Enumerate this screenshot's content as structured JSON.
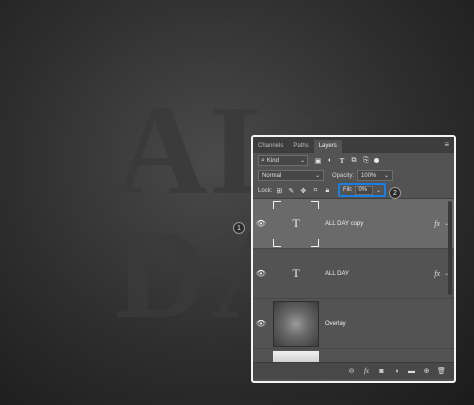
{
  "canvas": {
    "ghost_line_1": "ALL",
    "ghost_line_2": "DAY"
  },
  "panel": {
    "tabs": [
      {
        "label": "Channels",
        "active": false
      },
      {
        "label": "Paths",
        "active": false
      },
      {
        "label": "Layers",
        "active": true
      }
    ],
    "menu_icon": "panel-menu-icon",
    "filter": {
      "kind_label": "Kind",
      "icons": [
        "image-filter-icon",
        "adjustment-filter-icon",
        "type-filter-icon",
        "shape-filter-icon",
        "smartobject-filter-icon"
      ]
    },
    "blend": {
      "mode": "Normal",
      "opacity_label": "Opacity:",
      "opacity_value": "100%"
    },
    "lock": {
      "label": "Lock:",
      "icons": [
        "lock-transparent-icon",
        "lock-image-icon",
        "lock-position-icon",
        "lock-artboard-icon",
        "lock-all-icon"
      ],
      "fill_label": "Fill:",
      "fill_value": "0%"
    },
    "layers": [
      {
        "name": "ALL DAY copy",
        "type": "text",
        "selected": true,
        "fx": "fx"
      },
      {
        "name": "ALL DAY",
        "type": "text",
        "selected": false,
        "fx": "fx"
      },
      {
        "name": "Overlay",
        "type": "image",
        "selected": false,
        "fx": ""
      }
    ],
    "footer_icons": [
      "link-icon",
      "fx-icon",
      "mask-icon",
      "adjustment-icon",
      "group-folder-icon",
      "new-layer-icon",
      "trash-icon"
    ]
  },
  "badges": {
    "one": "1",
    "two": "2"
  },
  "colors": {
    "highlight": "#1a7fe0",
    "panel_bg": "#535353"
  }
}
